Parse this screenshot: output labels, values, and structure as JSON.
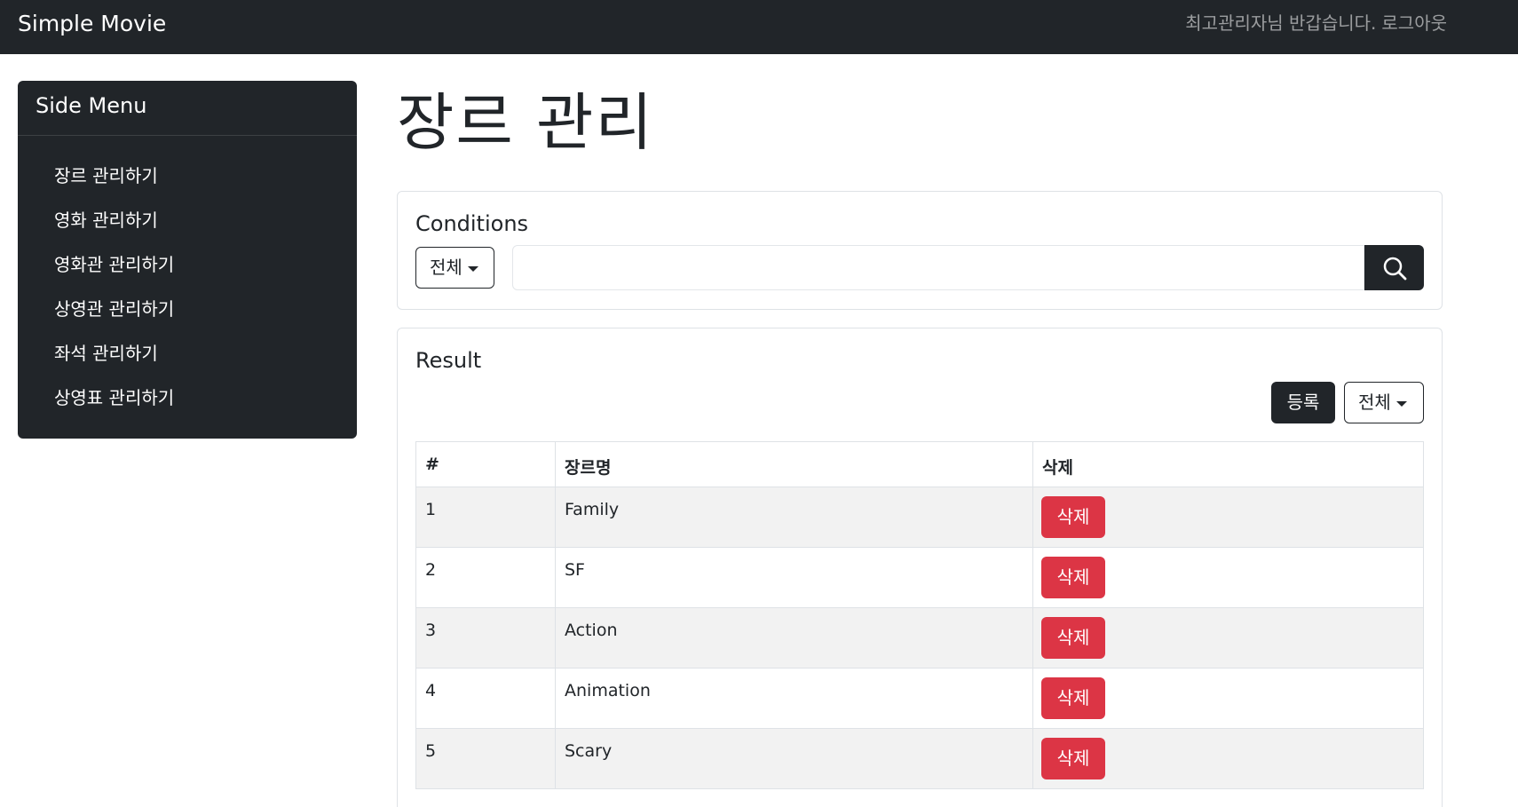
{
  "navbar": {
    "brand": "Simple Movie",
    "greeting": "최고관리자님 반갑습니다.",
    "logout": "로그아웃"
  },
  "sidebar": {
    "title": "Side Menu",
    "items": [
      {
        "label": "장르 관리하기"
      },
      {
        "label": "영화 관리하기"
      },
      {
        "label": "영화관 관리하기"
      },
      {
        "label": "상영관 관리하기"
      },
      {
        "label": "좌석 관리하기"
      },
      {
        "label": "상영표 관리하기"
      }
    ]
  },
  "page": {
    "title": "장르 관리"
  },
  "conditions": {
    "title": "Conditions",
    "filter_selected": "전체",
    "search_value": "",
    "search_icon": "search-icon"
  },
  "result": {
    "title": "Result",
    "register_label": "등록",
    "filter_selected": "전체",
    "table": {
      "headers": [
        "#",
        "장르명",
        "삭제"
      ],
      "rows": [
        {
          "num": "1",
          "name": "Family",
          "delete": "삭제"
        },
        {
          "num": "2",
          "name": "SF",
          "delete": "삭제"
        },
        {
          "num": "3",
          "name": "Action",
          "delete": "삭제"
        },
        {
          "num": "4",
          "name": "Animation",
          "delete": "삭제"
        },
        {
          "num": "5",
          "name": "Scary",
          "delete": "삭제"
        }
      ]
    }
  },
  "colors": {
    "dark": "#212529",
    "danger": "#dc3545",
    "stripe": "#f2f2f2",
    "border": "#dee2e6"
  }
}
